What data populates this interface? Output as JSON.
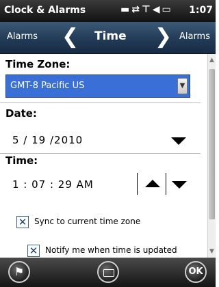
{
  "status_bar": {
    "app_title": "Clock & Alarms",
    "icons": [
      "battery-icon",
      "sync-icon",
      "signal-icon",
      "speaker-icon"
    ],
    "battery_icon_text": "▭",
    "time": "1:07"
  },
  "nav": {
    "prev_label": "Alarms",
    "title": "Time",
    "next_label": "Alarms"
  },
  "form": {
    "time_zone_label": "Time Zone:",
    "time_zone_value": "GMT-8 Pacific US",
    "date_label": "Date:",
    "date_value": "5  /  19  /2010",
    "time_label": "Time:",
    "time_value": "1   :  07  :  29    AM",
    "sync_checkbox_label": "Sync to current time zone",
    "sync_checked": true,
    "notify_checkbox_label": "Notify me when time is updated",
    "notify_checked": true
  },
  "bottom_bar": {
    "ok_label": "OK"
  },
  "colors": {
    "selection_blue": "#3a6fd8",
    "nav_bar": "#223b56",
    "status_bar": "#111111"
  }
}
